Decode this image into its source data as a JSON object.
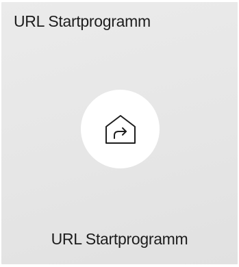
{
  "tile": {
    "title": "URL Startprogramm",
    "label": "URL Startprogramm",
    "icon": "home-share-icon",
    "colors": {
      "background": "#e6e6e6",
      "circle": "#ffffff",
      "text": "#1d1d1d",
      "icon_stroke": "#1d1d1d"
    }
  }
}
